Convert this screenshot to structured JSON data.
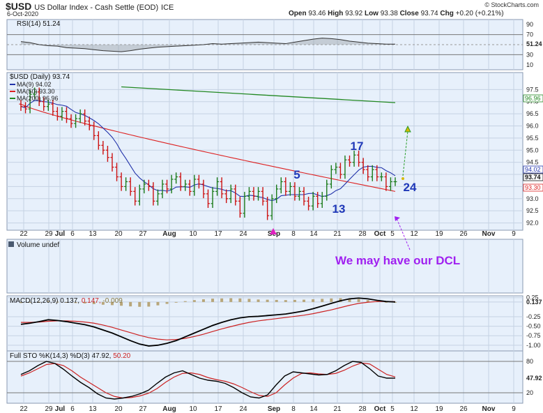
{
  "header": {
    "symbol": "$USD",
    "name": "US Dollar Index - Cash Settle (EOD)",
    "exchange": "ICE",
    "date": "6-Oct-2020",
    "open_label": "Open",
    "open": "93.46",
    "high_label": "High",
    "high": "93.92",
    "low_label": "Low",
    "low": "93.38",
    "close_label": "Close",
    "close": "93.74",
    "chg_label": "Chg",
    "chg": "+0.20 (+0.21%)",
    "brand": "© StockCharts.com"
  },
  "colors": {
    "price_bar_up": "#1a7a1a",
    "price_bar_down": "#cc1111",
    "ma9": "#2233aa",
    "ma50": "#dd2222",
    "ma200": "#228822",
    "wave_label": "#1f38b8",
    "annotation": "#a020f0",
    "panel_bg": "#e7f0fb",
    "grid": "#c5d2e3",
    "macd_line": "#000000",
    "macd_signal": "#cc2222",
    "macd_hist": "#b8a67a"
  },
  "chart_data": [
    {
      "type": "line",
      "panel": "RSI",
      "title": "RSI(14) 51.24",
      "yticks": [
        90,
        70,
        51.24,
        30,
        10
      ],
      "ylim": [
        0,
        100
      ],
      "overbought": 70,
      "oversold": 30,
      "series": [
        {
          "name": "RSI(14)",
          "values": [
            56,
            54,
            50,
            48,
            47,
            44,
            43,
            42,
            40,
            38,
            37,
            36,
            38,
            41,
            43,
            45,
            46,
            47,
            48,
            49,
            50,
            52,
            51,
            52,
            53,
            54,
            55,
            54,
            53,
            52,
            55,
            58,
            61,
            63,
            62,
            60,
            57,
            55,
            53,
            52,
            51,
            51
          ]
        }
      ]
    },
    {
      "type": "ohlc",
      "panel": "price",
      "title": "$USD (Daily) 93.74",
      "ylim": [
        91.7,
        98.2
      ],
      "yticks": [
        92.0,
        92.5,
        93.0,
        93.5,
        94.0,
        94.5,
        95.0,
        95.5,
        96.0,
        96.5,
        97.0,
        97.5
      ],
      "legend": [
        {
          "name": "MA(9) 94.02"
        },
        {
          "name": "MA(50) 93.30"
        },
        {
          "name": "MA(200) 96.96"
        }
      ],
      "last_values": [
        "94.02",
        "93.74",
        "93.30",
        "96.96"
      ],
      "closes": [
        96.8,
        96.7,
        97.3,
        97.4,
        97.0,
        96.8,
        96.9,
        96.6,
        96.4,
        96.6,
        96.3,
        96.1,
        96.3,
        96.5,
        96.2,
        96.0,
        95.6,
        95.2,
        95.0,
        94.7,
        94.3,
        93.9,
        93.5,
        93.7,
        93.3,
        92.9,
        93.4,
        93.6,
        93.5,
        92.9,
        93.2,
        93.6,
        93.4,
        93.8,
        93.9,
        93.5,
        93.6,
        93.3,
        93.8,
        93.6,
        93.2,
        92.8,
        93.3,
        93.7,
        93.2,
        93.0,
        93.4,
        92.9,
        92.4,
        93.1,
        93.3,
        93.1,
        93.3,
        92.9,
        92.3,
        93.0,
        93.4,
        93.7,
        93.3,
        93.5,
        93.1,
        93.3,
        92.9,
        92.7,
        93.1,
        92.8,
        93.1,
        93.6,
        94.2,
        94.3,
        94.0,
        94.6,
        94.5,
        94.8,
        94.5,
        94.2,
        93.9,
        94.2,
        93.9,
        93.9,
        93.5,
        93.7,
        93.7
      ],
      "ma9_end": 94.02,
      "ma50_end": 93.3,
      "ma200_end": 96.96,
      "annotations": [
        {
          "text": "5"
        },
        {
          "text": "17"
        },
        {
          "text": "13"
        },
        {
          "text": "24"
        }
      ]
    },
    {
      "type": "bar",
      "panel": "volume",
      "title": "Volume undef"
    },
    {
      "type": "line",
      "panel": "MACD",
      "title_main": "MACD(12,26,9) 0.137,",
      "title_signal": "0.147,",
      "title_hist": "-0.009",
      "ylim": [
        -1.15,
        0.3
      ],
      "yticks": [
        "0.25",
        "0.137",
        "-0.25",
        "-0.50",
        "-0.75",
        "-1.00"
      ],
      "series": [
        {
          "name": "MACD",
          "values": [
            -0.45,
            -0.42,
            -0.38,
            -0.33,
            -0.35,
            -0.38,
            -0.42,
            -0.46,
            -0.52,
            -0.6,
            -0.68,
            -0.78,
            -0.88,
            -0.97,
            -1.02,
            -1.0,
            -0.95,
            -0.88,
            -0.78,
            -0.68,
            -0.58,
            -0.48,
            -0.4,
            -0.33,
            -0.28,
            -0.25,
            -0.24,
            -0.22,
            -0.2,
            -0.18,
            -0.14,
            -0.1,
            -0.04,
            0.03,
            0.1,
            0.17,
            0.22,
            0.24,
            0.22,
            0.18,
            0.15,
            0.137
          ]
        },
        {
          "name": "Signal",
          "values": [
            -0.4,
            -0.4,
            -0.39,
            -0.37,
            -0.36,
            -0.36,
            -0.37,
            -0.39,
            -0.42,
            -0.47,
            -0.53,
            -0.6,
            -0.67,
            -0.74,
            -0.8,
            -0.84,
            -0.86,
            -0.85,
            -0.82,
            -0.77,
            -0.71,
            -0.64,
            -0.57,
            -0.51,
            -0.45,
            -0.4,
            -0.36,
            -0.33,
            -0.3,
            -0.27,
            -0.24,
            -0.21,
            -0.17,
            -0.12,
            -0.07,
            -0.01,
            0.05,
            0.1,
            0.13,
            0.15,
            0.15,
            0.147
          ]
        }
      ]
    },
    {
      "type": "line",
      "panel": "STO",
      "title_main": "Full STO %K(14,3) %D(3) 47.92,",
      "title_d": "50.20",
      "ylim": [
        0,
        100
      ],
      "yticks": [
        "80",
        "47.92",
        "20"
      ],
      "series": [
        {
          "name": "%K",
          "values": [
            55,
            62,
            72,
            80,
            76,
            65,
            52,
            40,
            30,
            18,
            10,
            8,
            10,
            13,
            18,
            25,
            38,
            50,
            58,
            62,
            55,
            48,
            44,
            42,
            38,
            30,
            20,
            12,
            10,
            16,
            35,
            52,
            60,
            58,
            56,
            54,
            55,
            62,
            72,
            80,
            78,
            66,
            52,
            48,
            47.92
          ]
        },
        {
          "name": "%D",
          "values": [
            52,
            58,
            66,
            74,
            76,
            72,
            62,
            50,
            40,
            30,
            20,
            13,
            10,
            11,
            14,
            19,
            28,
            40,
            50,
            57,
            58,
            55,
            49,
            45,
            42,
            37,
            30,
            22,
            15,
            13,
            20,
            35,
            48,
            57,
            58,
            56,
            55,
            57,
            63,
            71,
            77,
            75,
            65,
            55,
            50.2
          ]
        }
      ]
    }
  ],
  "xaxis": {
    "labels": [
      {
        "text": "22",
        "bold": false
      },
      {
        "text": "29",
        "bold": false
      },
      {
        "text": "Jul",
        "bold": true
      },
      {
        "text": "6",
        "bold": false
      },
      {
        "text": "13",
        "bold": false
      },
      {
        "text": "20",
        "bold": false
      },
      {
        "text": "27",
        "bold": false
      },
      {
        "text": "Aug",
        "bold": true
      },
      {
        "text": "10",
        "bold": false
      },
      {
        "text": "17",
        "bold": false
      },
      {
        "text": "24",
        "bold": false
      },
      {
        "text": "Sep",
        "bold": true
      },
      {
        "text": "8",
        "bold": false
      },
      {
        "text": "14",
        "bold": false
      },
      {
        "text": "21",
        "bold": false
      },
      {
        "text": "28",
        "bold": false
      },
      {
        "text": "Oct",
        "bold": true
      },
      {
        "text": "5",
        "bold": false
      },
      {
        "text": "12",
        "bold": false
      },
      {
        "text": "19",
        "bold": false
      },
      {
        "text": "26",
        "bold": false
      },
      {
        "text": "Nov",
        "bold": true
      },
      {
        "text": "9",
        "bold": false
      }
    ]
  },
  "annotation_text": "We may have our DCL"
}
